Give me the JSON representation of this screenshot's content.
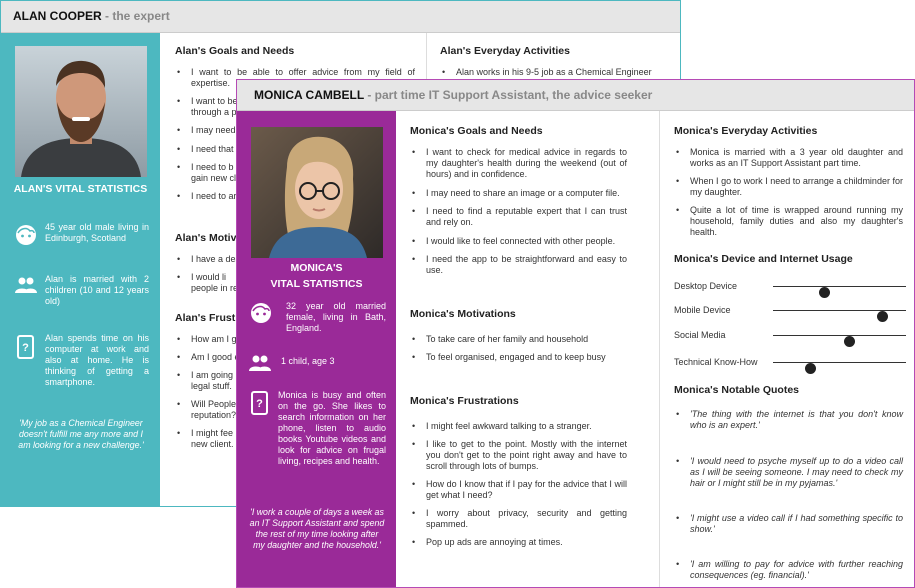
{
  "alan": {
    "header_name": "ALAN COOPER",
    "header_sub": " - the expert",
    "vital_title": "ALAN'S VITAL STATISTICS",
    "stats": [
      {
        "icon": "face-icon",
        "text": "45 year old male living in Edinburgh, Scotland"
      },
      {
        "icon": "people-icon",
        "text": "Alan is married with 2 children (10 and 12 years old)"
      },
      {
        "icon": "phone-icon",
        "text": "Alan spends time on his computer at work and also at home. He is thinking of getting a smartphone."
      }
    ],
    "quote": "'My job as a Chemical Engineer doesn't fulfill me any more and I am looking for a new challenge.'",
    "goals_title": "Alan's Goals and Needs",
    "goals": [
      "I want to be able to offer advice from my field of expertise.",
      "I want to be",
      "I may need",
      "I need that",
      "I need to b",
      "I need to ar"
    ],
    "goals_2_line2": "through a p",
    "goals_5_line2": "gain new cli",
    "motivations_title": "Alan's Motiva",
    "motivations": [
      "I have a des",
      "I would li"
    ],
    "motivations_2_line2": "people in re",
    "frustrations_title": "Alan's Frustra",
    "frustrations": [
      "How am I g",
      "Am I good e",
      "I am going",
      "Will People",
      "I might fee"
    ],
    "frustrations_3_line2": "legal stuff.",
    "frustrations_4_line2": "reputation?",
    "frustrations_5_line2": "new client.",
    "activities_title": "Alan's Everyday Activities",
    "activities": [
      "Alan works in his 9-5 job as a Chemical Engineer"
    ]
  },
  "monica": {
    "header_name": "MONICA CAMBELL",
    "header_sub": " - part time IT Support Assistant, the advice seeker",
    "vital_title_1": "MONICA'S",
    "vital_title_2": "VITAL STATISTICS",
    "stats": [
      {
        "icon": "face-icon",
        "text": "32 year old married female, living in Bath, England."
      },
      {
        "icon": "people-icon",
        "text": "1 child, age 3"
      },
      {
        "icon": "phone-icon",
        "text": "Monica is busy and often on the go. She likes to search information on her phone, listen to audio books Youtube videos and look for advice on frugal living, recipes and health."
      }
    ],
    "quote": "'I work a couple of days a week as an IT Support Assistant and spend the rest of my time looking after my daughter and the household.'",
    "goals_title": "Monica's Goals and Needs",
    "goals": [
      "I want to check for medical advice in regards to my daughter's health during the weekend (out of hours) and in confidence.",
      "I may need to share an image or a computer file.",
      "I need to find a reputable expert that I can trust and rely on.",
      "I would like to feel connected with other people.",
      "I need the app to be straightforward and easy to use."
    ],
    "motivations_title": "Monica's Motivations",
    "motivations": [
      "To take care of her family and household",
      "To feel organised, engaged and to keep busy"
    ],
    "frustrations_title": "Monica's Frustrations",
    "frustrations": [
      "I might feel awkward talking to a stranger.",
      "I like to get to the point. Mostly with the internet you don't get to the point right away and have to scroll through lots of bumps.",
      "How do I know that if I pay for the advice that I will get what I need?",
      "I worry about privacy, security and getting spammed.",
      "Pop up ads are annoying at times."
    ],
    "activities_title": "Monica's Everyday Activities",
    "activities": [
      "Monica is married with a 3 year old daughter and works as an IT Support Assistant part time.",
      "When I go to work I need to arrange a childminder for my daughter.",
      "Quite a lot of time is wrapped around running my household, family duties and also my daughter's health."
    ],
    "device_title": "Monica's Device and Internet Usage",
    "usage": [
      {
        "label": "Desktop Device",
        "level": 0.38
      },
      {
        "label": "Mobile Device",
        "level": 0.82
      },
      {
        "label": "Social Media",
        "level": 0.57
      },
      {
        "label": "Technical Know-How",
        "level": 0.28
      }
    ],
    "quotes_title": "Monica's Notable Quotes",
    "quotes": [
      "'The thing with the internet is that you don't know who is an expert.'",
      "'I would need to psyche myself up to do a video call as I will be seeing someone. I may need to check my hair or I might still be in my pyjamas.'",
      "'I might use a video call if I had something specific to show.'",
      "'I am willing to pay for advice with further reaching consequences (eg. financial).'"
    ]
  }
}
